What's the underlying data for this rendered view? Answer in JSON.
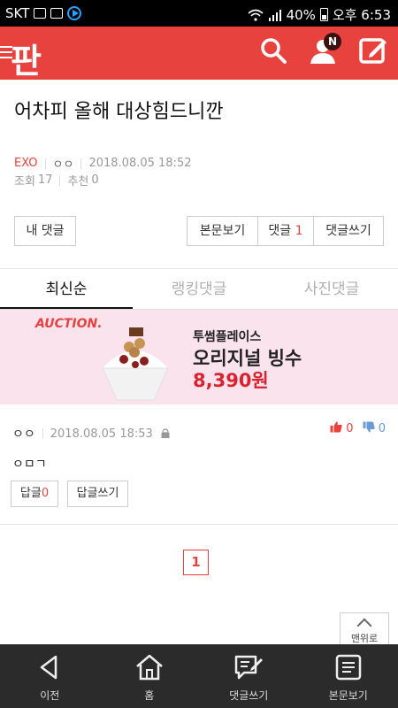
{
  "status_bar": {
    "carrier": "SKT",
    "battery": "40%",
    "time": "오후 6:53"
  },
  "header": {
    "logo": "판",
    "notification_badge": "N"
  },
  "post": {
    "title": "어차피 올해 대상힘드니깐",
    "category": "EXO",
    "author": "ㅇㅇ",
    "datetime": "2018.08.05 18:52",
    "views_label": "조회",
    "views": "17",
    "recommend_label": "추천",
    "recommend": "0"
  },
  "actions": {
    "my_comments": "내 댓글",
    "view_post": "본문보기",
    "comments_label": "댓글",
    "comments_count": "1",
    "write_comment": "댓글쓰기"
  },
  "tabs": [
    "최신순",
    "랭킹댓글",
    "사진댓글"
  ],
  "ad": {
    "brand": "AUCTION.",
    "line1": "투썸플레이스",
    "line2": "오리지널 빙수",
    "line3": "8,390원"
  },
  "comment": {
    "author": "ㅇㅇ",
    "datetime": "2018.08.05 18:53",
    "up_count": "0",
    "down_count": "0",
    "body": "ㅇㅁㄱ",
    "reply_label": "답글",
    "reply_count": "0",
    "write_reply": "답글쓰기"
  },
  "pagination": {
    "current_page": "1"
  },
  "to_top": "맨위로",
  "bottom_nav": {
    "back": "이전",
    "home": "홈",
    "write_comment": "댓글쓰기",
    "view_post": "본문보기"
  },
  "colors": {
    "brand_red": "#e8423f",
    "nav_dark": "#2b2b2b",
    "ad_background": "#fbe3ee"
  }
}
